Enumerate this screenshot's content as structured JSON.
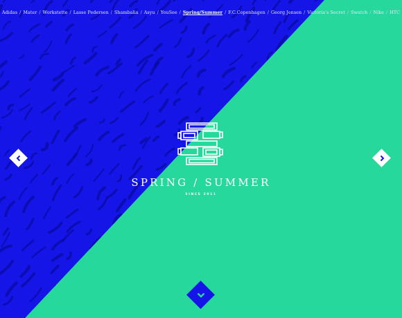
{
  "nav": {
    "items": [
      {
        "label": "Adidas"
      },
      {
        "label": "Mater"
      },
      {
        "label": "Workstette"
      },
      {
        "label": "Lasse Pedersen"
      },
      {
        "label": "Shambalia"
      },
      {
        "label": "Asyu"
      },
      {
        "label": "YouSee"
      },
      {
        "label": "Spring/Summer",
        "active": true
      },
      {
        "label": "F.C.Copenhagen"
      },
      {
        "label": "Georg Jensen"
      },
      {
        "label": "Victoria's Secret"
      },
      {
        "label": "Swatch"
      },
      {
        "label": "Nike"
      },
      {
        "label": "HTC"
      }
    ],
    "separator": "/"
  },
  "hero": {
    "title": "SPRING / SUMMER",
    "subtitle": "SINCE 2011"
  },
  "colors": {
    "blue": "#1515e8",
    "green": "#27d89c",
    "white": "#ffffff"
  },
  "icons": {
    "prev": "chevron-left-icon",
    "next": "chevron-right-icon",
    "down": "chevron-down-icon",
    "logo": "spring-summer-logo"
  }
}
